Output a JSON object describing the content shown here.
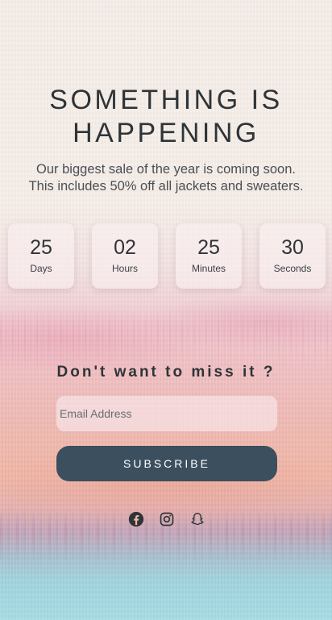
{
  "hero": {
    "title_line1": "SOMETHING IS",
    "title_line2": "HAPPENING",
    "subtitle_line1": "Our biggest sale of the year is coming soon.",
    "subtitle_line2": "This includes 50% off all jackets and sweaters."
  },
  "countdown": [
    {
      "value": "25",
      "label": "Days"
    },
    {
      "value": "02",
      "label": "Hours"
    },
    {
      "value": "25",
      "label": "Minutes"
    },
    {
      "value": "30",
      "label": "Seconds"
    }
  ],
  "signup": {
    "heading": "Don't want to miss it ?",
    "email_placeholder": "Email Address",
    "button_label": "SUBSCRIBE"
  },
  "social": {
    "icons": [
      "facebook-icon",
      "instagram-icon",
      "snapchat-icon"
    ]
  },
  "colors": {
    "button_bg": "#3b4f5e",
    "text_dark": "#2f3438"
  }
}
